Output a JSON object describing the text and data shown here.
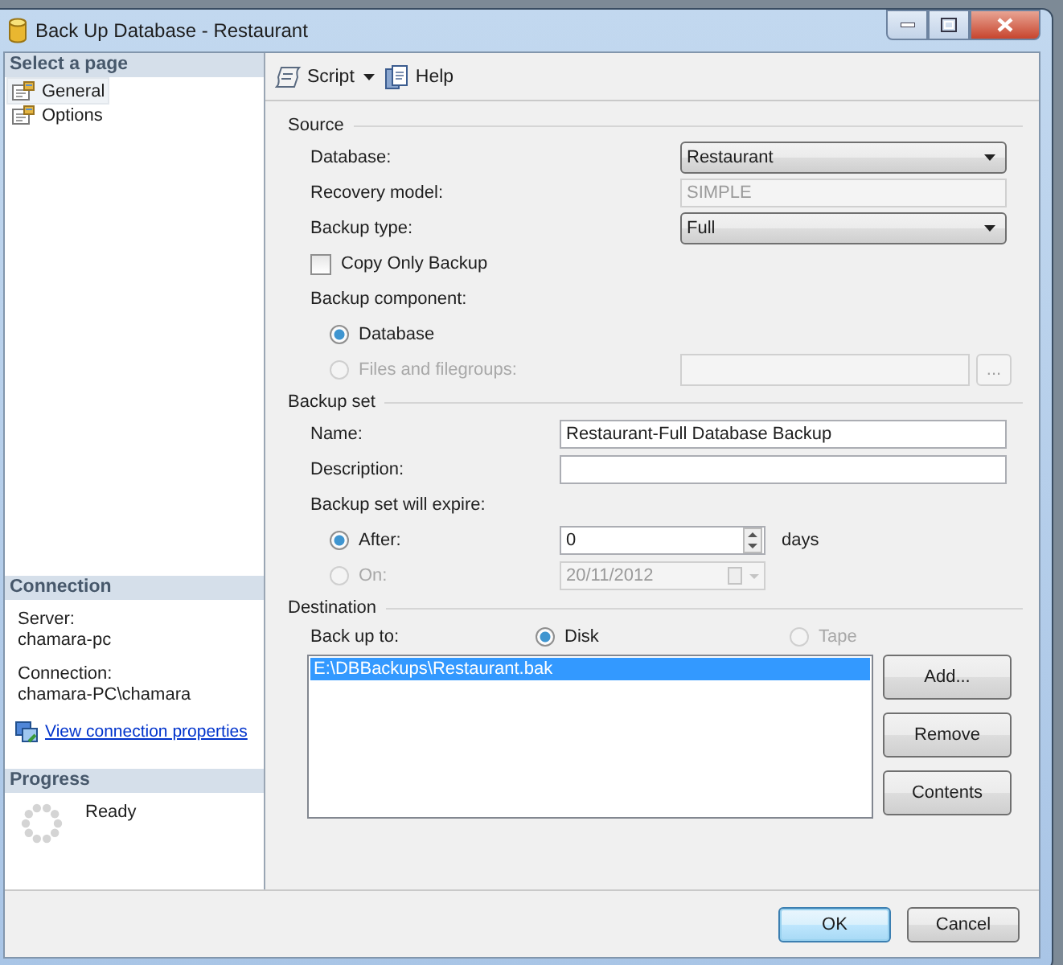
{
  "window": {
    "title": "Back Up Database - Restaurant"
  },
  "sidebar": {
    "heading": "Select a page",
    "pages": [
      {
        "label": "General",
        "selected": true
      },
      {
        "label": "Options",
        "selected": false
      }
    ]
  },
  "connection": {
    "heading": "Connection",
    "server_label": "Server:",
    "server": "chamara-pc",
    "connection_label": "Connection:",
    "connection": "chamara-PC\\chamara",
    "link": "View connection properties"
  },
  "progress": {
    "heading": "Progress",
    "status": "Ready"
  },
  "toolbar": {
    "script": "Script",
    "help": "Help"
  },
  "source": {
    "title": "Source",
    "database_label": "Database:",
    "database": "Restaurant",
    "recovery_label": "Recovery model:",
    "recovery": "SIMPLE",
    "type_label": "Backup type:",
    "type": "Full",
    "copy_only": {
      "label": "Copy Only Backup",
      "checked": false
    },
    "component_label": "Backup component:",
    "components": [
      {
        "label": "Database",
        "selected": true,
        "disabled": false
      },
      {
        "label": "Files and filegroups:",
        "selected": false,
        "disabled": true
      }
    ],
    "browse": "..."
  },
  "backup_set": {
    "title": "Backup set",
    "name_label": "Name:",
    "name": "Restaurant-Full Database Backup",
    "description_label": "Description:",
    "expire_label": "Backup set will expire:",
    "expire": [
      {
        "label": "After:",
        "selected": true,
        "disabled": false,
        "kind": "spin",
        "value": "0",
        "unit": "days"
      },
      {
        "label": "On:",
        "selected": false,
        "disabled": true,
        "kind": "date",
        "value": "20/11/2012"
      }
    ]
  },
  "destination": {
    "title": "Destination",
    "backup_to_label": "Back up to:",
    "media": [
      {
        "label": "Disk",
        "selected": true,
        "disabled": false
      },
      {
        "label": "Tape",
        "selected": false,
        "disabled": true
      }
    ],
    "files": [
      {
        "path": "E:\\DBBackups\\Restaurant.bak",
        "selected": true
      }
    ],
    "buttons": [
      "Add...",
      "Remove",
      "Contents"
    ]
  },
  "footer_buttons": [
    {
      "label": "OK",
      "default": true
    },
    {
      "label": "Cancel",
      "default": false
    }
  ]
}
